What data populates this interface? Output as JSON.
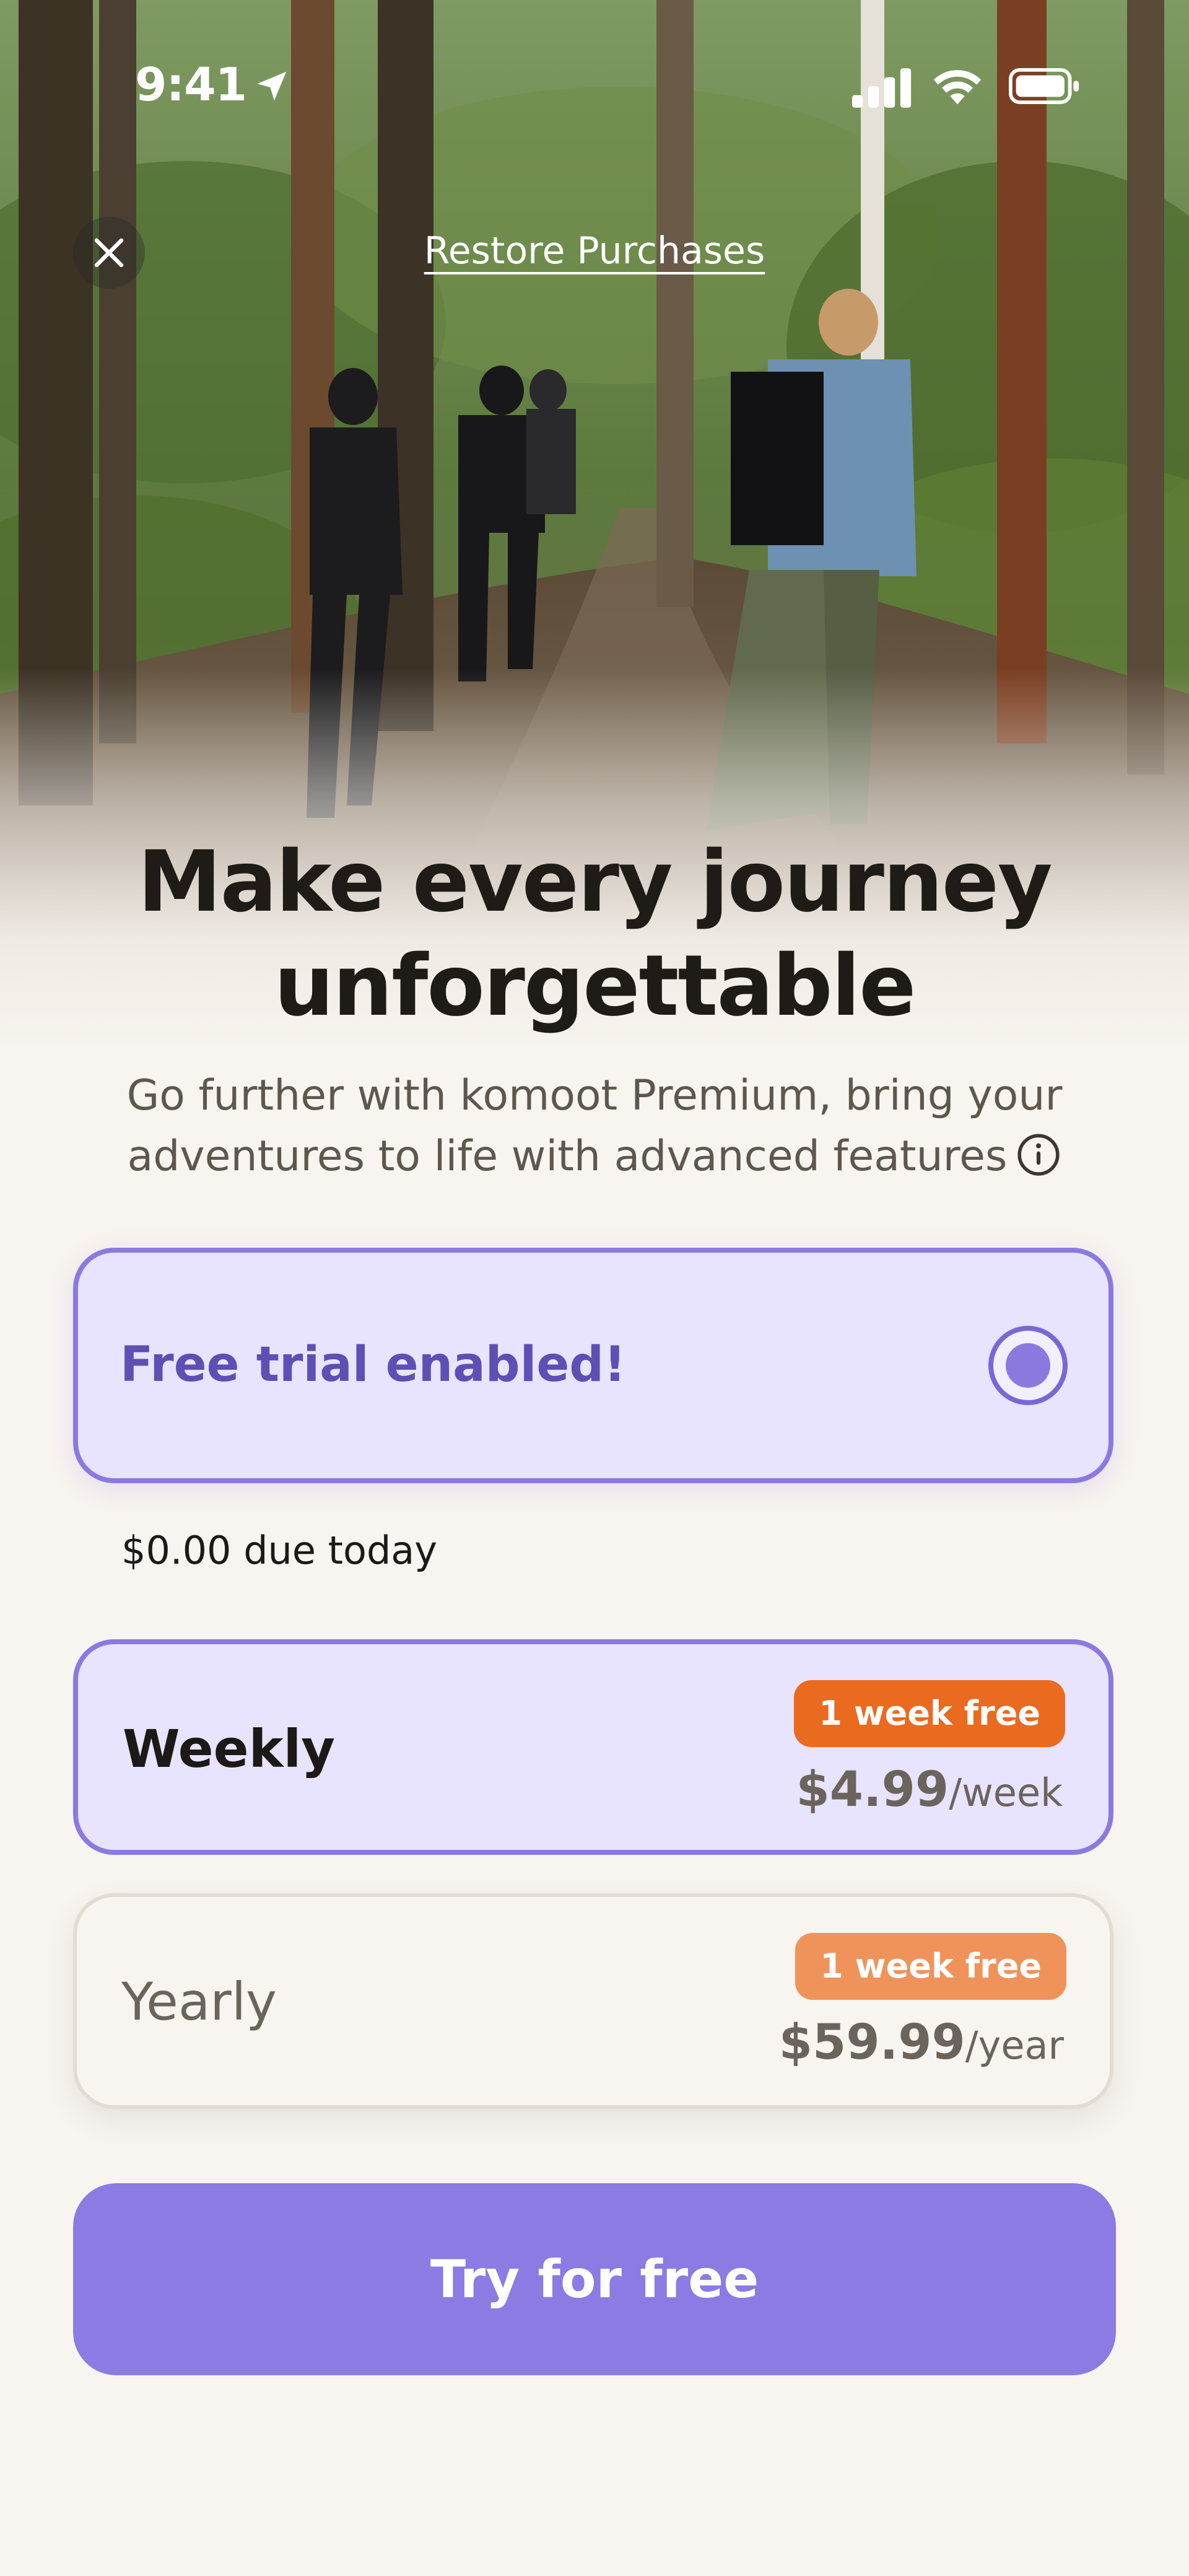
{
  "status_bar": {
    "time": "9:41",
    "icons": [
      "location-arrow-icon",
      "cellular-signal-icon",
      "wifi-icon",
      "battery-icon"
    ]
  },
  "header": {
    "close_icon": "close-icon",
    "restore_label": "Restore Purchases"
  },
  "hero": {
    "image": "hikers-walking-forest-trail"
  },
  "main": {
    "headline_line1": "Make every journey",
    "headline_line2": "unforgettable",
    "subhead_line1": "Go further with komoot Premium, bring your",
    "subhead_line2": "adventures to life with advanced features",
    "info_icon": "info-icon"
  },
  "trial": {
    "label": "Free trial enabled!",
    "enabled": true,
    "due_today": "$0.00 due today"
  },
  "plans": [
    {
      "name": "Weekly",
      "badge": "1 week free",
      "price": "$4.99",
      "period": "/week",
      "selected": true
    },
    {
      "name": "Yearly",
      "badge": "1 week free",
      "price": "$59.99",
      "period": "/year",
      "selected": false
    }
  ],
  "cta": {
    "label": "Try for free"
  },
  "colors": {
    "accent": "#8b7be3",
    "accent_border": "#8c79df",
    "selected_bg": "#e8e3ff",
    "badge_orange": "#ea6a1f",
    "badge_orange_light": "#f0935a",
    "background": "#f8f4ef"
  }
}
